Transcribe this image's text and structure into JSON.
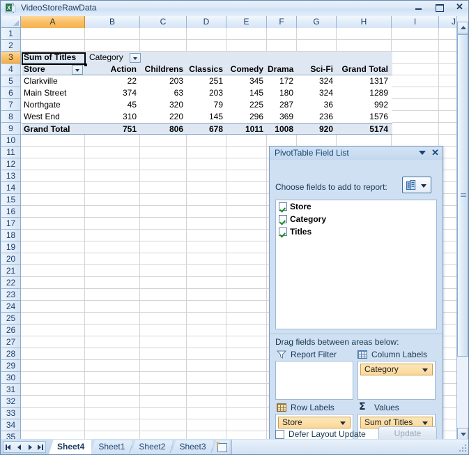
{
  "window": {
    "title": "VideoStoreRawData",
    "icon": "excel-icon",
    "minimize_label": "Minimize",
    "maximize_label": "Maximize",
    "close_label": "Close"
  },
  "grid": {
    "columns": [
      "A",
      "B",
      "C",
      "D",
      "E",
      "F",
      "G",
      "H",
      "I",
      "J"
    ],
    "selected_column": "A",
    "selected_row": "3",
    "rows": [
      "1",
      "2",
      "3",
      "4",
      "5",
      "6",
      "7",
      "8",
      "9",
      "10",
      "11",
      "12",
      "13",
      "14",
      "15",
      "16",
      "17",
      "18",
      "19",
      "20",
      "21",
      "22",
      "23",
      "24",
      "25",
      "26",
      "27",
      "28",
      "29",
      "30",
      "31",
      "32",
      "33",
      "34",
      "35"
    ]
  },
  "pivot": {
    "value_header": "Sum of Titles",
    "column_field": "Category",
    "row_field": "Store",
    "grand_total_label": "Grand Total",
    "column_headers": [
      "Action",
      "Childrens",
      "Classics",
      "Comedy",
      "Drama",
      "Sci-Fi",
      "Grand Total"
    ],
    "rows": [
      {
        "store": "Clarkville",
        "values": [
          22,
          203,
          251,
          345,
          172,
          324
        ],
        "total": 1317
      },
      {
        "store": "Main Street",
        "values": [
          374,
          63,
          203,
          145,
          180,
          324
        ],
        "total": 1289
      },
      {
        "store": "Northgate",
        "values": [
          45,
          320,
          79,
          225,
          287,
          36
        ],
        "total": 992
      },
      {
        "store": "West End",
        "values": [
          310,
          220,
          145,
          296,
          369,
          236
        ],
        "total": 1576
      }
    ],
    "grand_total": {
      "values": [
        751,
        806,
        678,
        1011,
        1008,
        920
      ],
      "total": 5174
    }
  },
  "field_list": {
    "title": "PivotTable Field List",
    "menu_label": "Panel menu",
    "close_label": "Close",
    "choose_label": "Choose fields to add to report:",
    "view_button_label": "Field list view options",
    "fields": [
      {
        "name": "Store",
        "checked": true
      },
      {
        "name": "Category",
        "checked": true
      },
      {
        "name": "Titles",
        "checked": true
      }
    ],
    "drag_label": "Drag fields between areas below:",
    "zones": [
      {
        "id": "report-filter",
        "label": "Report Filter",
        "icon": "filter-icon",
        "chip": null
      },
      {
        "id": "column-labels",
        "label": "Column Labels",
        "icon": "grid-icon",
        "chip": "Category"
      },
      {
        "id": "row-labels",
        "label": "Row Labels",
        "icon": "grid-icon",
        "chip": "Store"
      },
      {
        "id": "values",
        "label": "Values",
        "icon": "sigma-icon",
        "chip": "Sum of Titles"
      }
    ],
    "defer_label": "Defer Layout Update",
    "defer_checked": false,
    "update_label": "Update",
    "update_enabled": false
  },
  "tabs": {
    "navigation": [
      "first-sheet",
      "previous-sheet",
      "next-sheet",
      "last-sheet"
    ],
    "sheets": [
      {
        "label": "Sheet4",
        "active": true
      },
      {
        "label": "Sheet1",
        "active": false
      },
      {
        "label": "Sheet2",
        "active": false
      },
      {
        "label": "Sheet3",
        "active": false
      }
    ],
    "new_sheet_label": "Insert Worksheet"
  },
  "colors": {
    "accent": "#f6b04d",
    "pivot_header_bg": "#dfe8f2",
    "panel_bg": "#cfe0f2",
    "chip_bg": "#fbd89a"
  }
}
